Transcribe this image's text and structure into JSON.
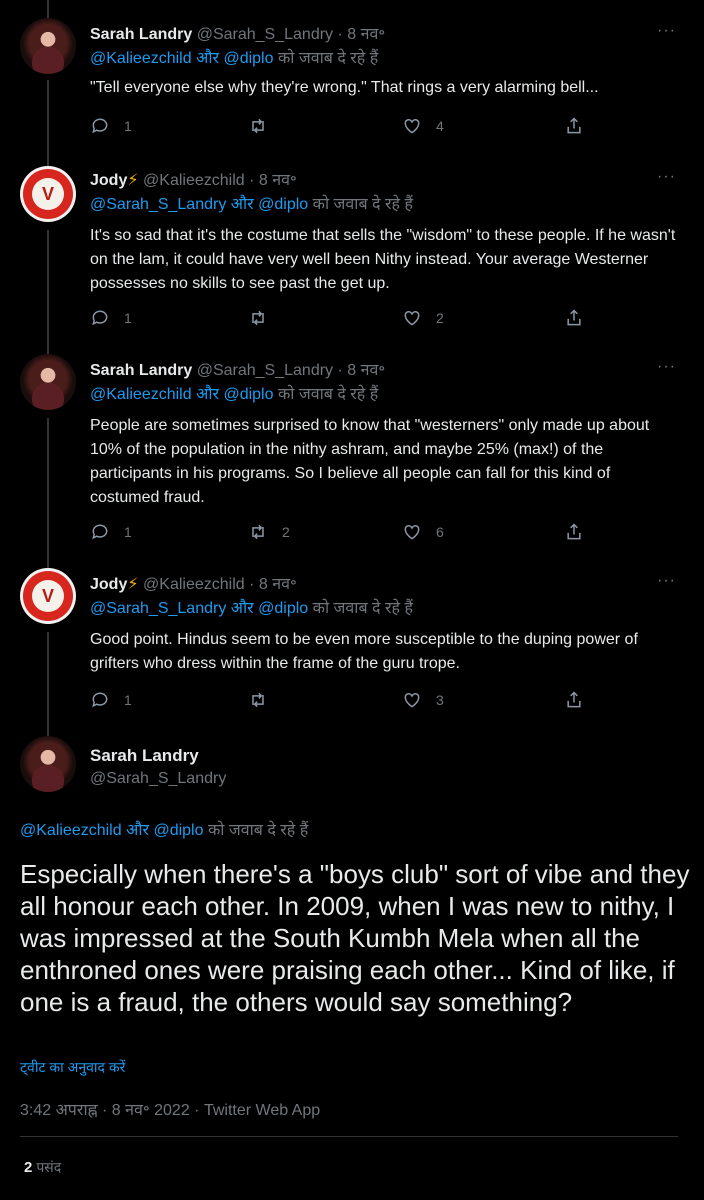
{
  "tweets": [
    {
      "name": "Sarah Landry",
      "badge": "",
      "handle": "@Sarah_S_Landry",
      "time": "8 नव॰",
      "reply_users": [
        "@Kalieezchild",
        "@diplo"
      ],
      "reply_and": "और",
      "reply_suffix": "को जवाब दे रहे हैं",
      "text": "\"Tell everyone else why they're wrong.\" That rings a very alarming bell...",
      "replies": "1",
      "retweets": "",
      "likes": "4"
    },
    {
      "name": "Jody",
      "badge": "⚡",
      "handle": "@Kalieezchild",
      "time": "8 नव॰",
      "reply_users": [
        "@Sarah_S_Landry",
        "@diplo"
      ],
      "reply_and": "और",
      "reply_suffix": "को जवाब दे रहे हैं",
      "text": "It's so sad that it's the costume that sells the \"wisdom\" to these people. If he wasn't on the lam, it could have very well been Nithy instead. Your average Westerner possesses no skills to see past the get up.",
      "replies": "1",
      "retweets": "",
      "likes": "2"
    },
    {
      "name": "Sarah Landry",
      "badge": "",
      "handle": "@Sarah_S_Landry",
      "time": "8 नव॰",
      "reply_users": [
        "@Kalieezchild",
        "@diplo"
      ],
      "reply_and": "और",
      "reply_suffix": "को जवाब दे रहे हैं",
      "text": "People are sometimes surprised to know that \"westerners\" only made up about 10% of the population in the nithy ashram, and maybe 25% (max!) of the participants in his programs. So I believe all people can fall for this kind of costumed fraud.",
      "replies": "1",
      "retweets": "2",
      "likes": "6"
    },
    {
      "name": "Jody",
      "badge": "⚡",
      "handle": "@Kalieezchild",
      "time": "8 नव॰",
      "reply_users": [
        "@Sarah_S_Landry",
        "@diplo"
      ],
      "reply_and": "और",
      "reply_suffix": "को जवाब दे रहे हैं",
      "text": "Good point. Hindus seem to be even more susceptible to the duping power of grifters who dress within the frame of the guru trope.",
      "replies": "1",
      "retweets": "",
      "likes": "3"
    }
  ],
  "focus": {
    "name": "Sarah Landry",
    "handle": "@Sarah_S_Landry",
    "reply_users": [
      "@Kalieezchild",
      "@diplo"
    ],
    "reply_and": "और",
    "reply_suffix": "को जवाब दे रहे हैं",
    "text": "Especially when there's a \"boys club\" sort of vibe and they all honour each other. In 2009, when I was new to nithy, I was impressed at the South Kumbh Mela when all the enthroned ones were praising each other... Kind of like, if one is a fraud, the others would say something?",
    "translate": "ट्वीट का अनुवाद करें",
    "timestamp": "3:42 अपराह्न · 8 नव॰ 2022 · Twitter Web App",
    "likes_count": "2",
    "likes_label": "पसंद"
  },
  "ui": {
    "dot": "·",
    "more": "···"
  },
  "colors": {
    "background": "#000000",
    "text": "#e7e9ea",
    "muted": "#71767b",
    "link": "#1d9bf0",
    "bolt": "#f5b400"
  },
  "icons": [
    "reply-icon",
    "retweet-icon",
    "like-icon",
    "share-icon",
    "more-icon",
    "lightning-icon"
  ]
}
